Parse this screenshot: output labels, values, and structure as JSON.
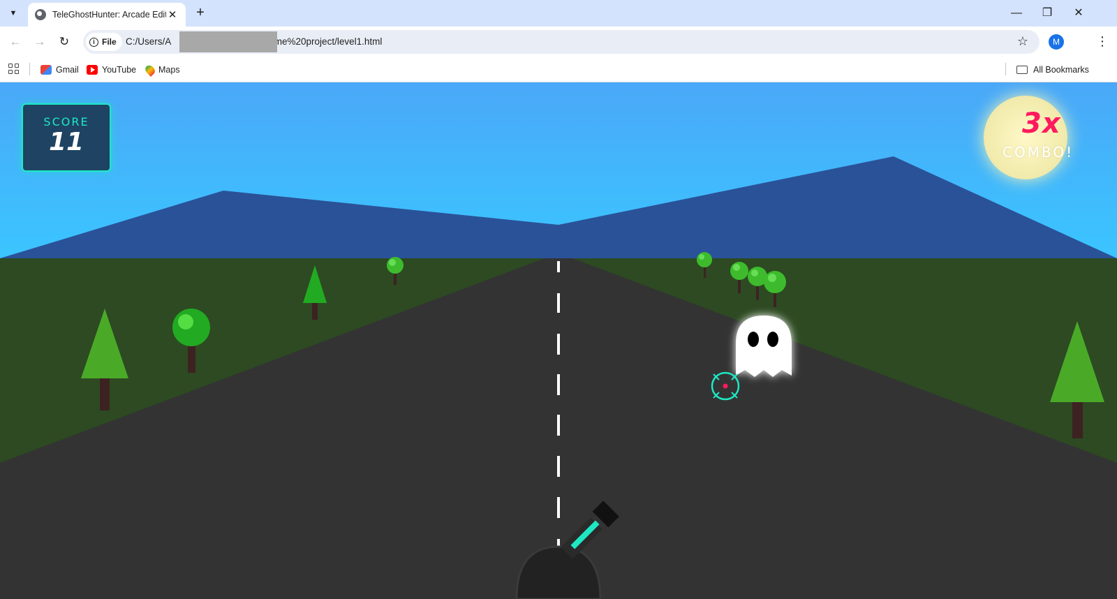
{
  "browser": {
    "tab_title": "TeleGhostHunter: Arcade Edition",
    "new_tab": "+",
    "window_controls": {
      "minimize": "—",
      "restore": "❐",
      "close": "✕"
    },
    "address_chip": "File",
    "url_prefix": "C:/Users/A",
    "url_suffix": "ame%20project/level1.html",
    "profile_initial": "M",
    "bookmarks": [
      {
        "label": "Gmail",
        "icon": "gmail-icon"
      },
      {
        "label": "YouTube",
        "icon": "youtube-icon"
      },
      {
        "label": "Maps",
        "icon": "maps-icon"
      }
    ],
    "all_bookmarks_label": "All Bookmarks"
  },
  "game": {
    "score_label": "SCORE",
    "score_value": "11",
    "combo_multiplier": "3x",
    "combo_label": "COMBO!",
    "colors": {
      "sky": "#3ac6ff",
      "mountains": "#2a5298",
      "grass": "#2d4a22",
      "road": "#333333",
      "accent": "#1ee8c4",
      "combo": "#ff1a5e"
    }
  }
}
